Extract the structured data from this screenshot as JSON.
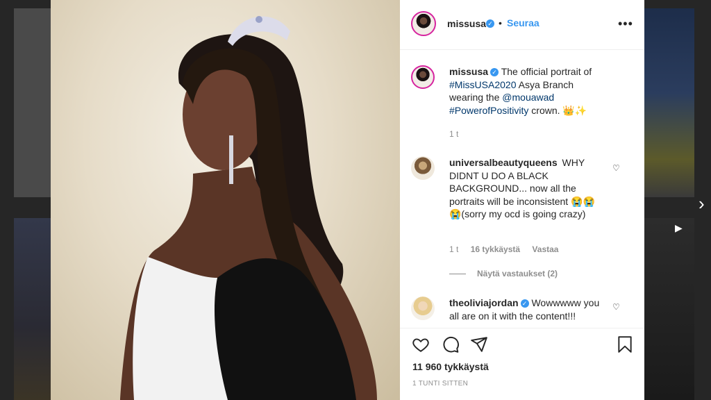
{
  "post": {
    "username": "missusa",
    "follow_label": "Seuraa",
    "caption": {
      "username": "missusa",
      "text_1": "The official portrait of",
      "hashtag_1": "#MissUSA2020",
      "text_2": "Asya Branch wearing the",
      "mention": "@mouawad",
      "hashtag_2": "#PowerofPositivity",
      "text_3": "crown. 👑✨",
      "age": "1 t"
    },
    "comments": [
      {
        "username": "universalbeautyqueens",
        "text": "WHY DIDNT U DO A BLACK BACKGROUND... now all the portraits will be inconsistent 😭😭😭(sorry my ocd is going crazy)",
        "age": "1 t",
        "likes": "16 tykkäystä",
        "reply": "Vastaa"
      },
      {
        "username": "theoliviajordan",
        "text": "Wowwwww you all are on it with the content!!!"
      }
    ],
    "view_replies": "Näytä vastaukset (2)",
    "likes_count": "11 960 tykkäystä",
    "posted_ago": "1 TUNTI SITTEN"
  },
  "icons": {
    "verified": "✓",
    "heart": "♡",
    "more": "•••",
    "next": "›",
    "video": "▶"
  },
  "colors": {
    "accent": "#3897f0",
    "muted": "#8e8e8e",
    "backdrop": "#262626"
  }
}
